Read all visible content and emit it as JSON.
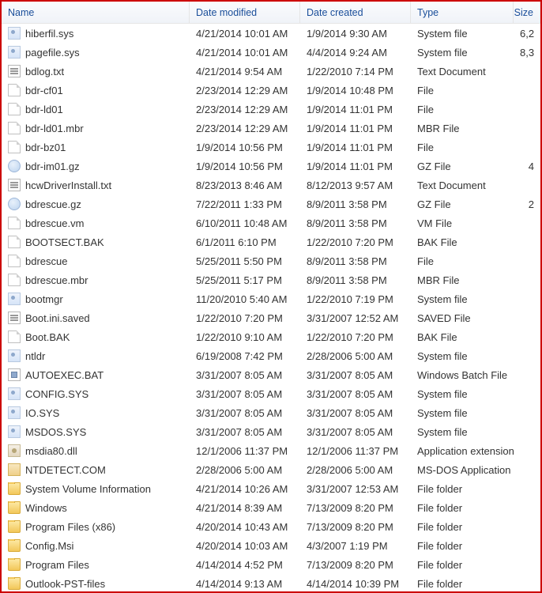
{
  "columns": {
    "name": "Name",
    "modified": "Date modified",
    "created": "Date created",
    "type": "Type",
    "size": "Size"
  },
  "files": [
    {
      "icon": "sys",
      "name": "hiberfil.sys",
      "modified": "4/21/2014 10:01 AM",
      "created": "1/9/2014 9:30 AM",
      "type": "System file",
      "size": "6,2"
    },
    {
      "icon": "sys",
      "name": "pagefile.sys",
      "modified": "4/21/2014 10:01 AM",
      "created": "4/4/2014 9:24 AM",
      "type": "System file",
      "size": "8,3"
    },
    {
      "icon": "txt",
      "name": "bdlog.txt",
      "modified": "4/21/2014 9:54 AM",
      "created": "1/22/2010 7:14 PM",
      "type": "Text Document",
      "size": ""
    },
    {
      "icon": "file",
      "name": "bdr-cf01",
      "modified": "2/23/2014 12:29 AM",
      "created": "1/9/2014 10:48 PM",
      "type": "File",
      "size": ""
    },
    {
      "icon": "file",
      "name": "bdr-ld01",
      "modified": "2/23/2014 12:29 AM",
      "created": "1/9/2014 11:01 PM",
      "type": "File",
      "size": ""
    },
    {
      "icon": "file",
      "name": "bdr-ld01.mbr",
      "modified": "2/23/2014 12:29 AM",
      "created": "1/9/2014 11:01 PM",
      "type": "MBR File",
      "size": ""
    },
    {
      "icon": "file",
      "name": "bdr-bz01",
      "modified": "1/9/2014 10:56 PM",
      "created": "1/9/2014 11:01 PM",
      "type": "File",
      "size": ""
    },
    {
      "icon": "gz",
      "name": "bdr-im01.gz",
      "modified": "1/9/2014 10:56 PM",
      "created": "1/9/2014 11:01 PM",
      "type": "GZ File",
      "size": "4"
    },
    {
      "icon": "txt",
      "name": "hcwDriverInstall.txt",
      "modified": "8/23/2013 8:46 AM",
      "created": "8/12/2013 9:57 AM",
      "type": "Text Document",
      "size": ""
    },
    {
      "icon": "gz",
      "name": "bdrescue.gz",
      "modified": "7/22/2011 1:33 PM",
      "created": "8/9/2011 3:58 PM",
      "type": "GZ File",
      "size": "2"
    },
    {
      "icon": "file",
      "name": "bdrescue.vm",
      "modified": "6/10/2011 10:48 AM",
      "created": "8/9/2011 3:58 PM",
      "type": "VM File",
      "size": ""
    },
    {
      "icon": "file",
      "name": "BOOTSECT.BAK",
      "modified": "6/1/2011 6:10 PM",
      "created": "1/22/2010 7:20 PM",
      "type": "BAK File",
      "size": ""
    },
    {
      "icon": "file",
      "name": "bdrescue",
      "modified": "5/25/2011 5:50 PM",
      "created": "8/9/2011 3:58 PM",
      "type": "File",
      "size": ""
    },
    {
      "icon": "file",
      "name": "bdrescue.mbr",
      "modified": "5/25/2011 5:17 PM",
      "created": "8/9/2011 3:58 PM",
      "type": "MBR File",
      "size": ""
    },
    {
      "icon": "sys",
      "name": "bootmgr",
      "modified": "11/20/2010 5:40 AM",
      "created": "1/22/2010 7:19 PM",
      "type": "System file",
      "size": ""
    },
    {
      "icon": "txt",
      "name": "Boot.ini.saved",
      "modified": "1/22/2010 7:20 PM",
      "created": "3/31/2007 12:52 AM",
      "type": "SAVED File",
      "size": ""
    },
    {
      "icon": "file",
      "name": "Boot.BAK",
      "modified": "1/22/2010 9:10 AM",
      "created": "1/22/2010 7:20 PM",
      "type": "BAK File",
      "size": ""
    },
    {
      "icon": "sys",
      "name": "ntldr",
      "modified": "6/19/2008 7:42 PM",
      "created": "2/28/2006 5:00 AM",
      "type": "System file",
      "size": ""
    },
    {
      "icon": "bat",
      "name": "AUTOEXEC.BAT",
      "modified": "3/31/2007 8:05 AM",
      "created": "3/31/2007 8:05 AM",
      "type": "Windows Batch File",
      "size": ""
    },
    {
      "icon": "sys",
      "name": "CONFIG.SYS",
      "modified": "3/31/2007 8:05 AM",
      "created": "3/31/2007 8:05 AM",
      "type": "System file",
      "size": ""
    },
    {
      "icon": "sys",
      "name": "IO.SYS",
      "modified": "3/31/2007 8:05 AM",
      "created": "3/31/2007 8:05 AM",
      "type": "System file",
      "size": ""
    },
    {
      "icon": "sys",
      "name": "MSDOS.SYS",
      "modified": "3/31/2007 8:05 AM",
      "created": "3/31/2007 8:05 AM",
      "type": "System file",
      "size": ""
    },
    {
      "icon": "dll",
      "name": "msdia80.dll",
      "modified": "12/1/2006 11:37 PM",
      "created": "12/1/2006 11:37 PM",
      "type": "Application extension",
      "size": ""
    },
    {
      "icon": "com",
      "name": "NTDETECT.COM",
      "modified": "2/28/2006 5:00 AM",
      "created": "2/28/2006 5:00 AM",
      "type": "MS-DOS Application",
      "size": ""
    },
    {
      "icon": "folder",
      "name": "System Volume Information",
      "modified": "4/21/2014 10:26 AM",
      "created": "3/31/2007 12:53 AM",
      "type": "File folder",
      "size": ""
    },
    {
      "icon": "folder",
      "name": "Windows",
      "modified": "4/21/2014 8:39 AM",
      "created": "7/13/2009 8:20 PM",
      "type": "File folder",
      "size": ""
    },
    {
      "icon": "folder",
      "name": "Program Files (x86)",
      "modified": "4/20/2014 10:43 AM",
      "created": "7/13/2009 8:20 PM",
      "type": "File folder",
      "size": ""
    },
    {
      "icon": "folder",
      "name": "Config.Msi",
      "modified": "4/20/2014 10:03 AM",
      "created": "4/3/2007 1:19 PM",
      "type": "File folder",
      "size": ""
    },
    {
      "icon": "folder",
      "name": "Program Files",
      "modified": "4/14/2014 4:52 PM",
      "created": "7/13/2009 8:20 PM",
      "type": "File folder",
      "size": ""
    },
    {
      "icon": "folder",
      "name": "Outlook-PST-files",
      "modified": "4/14/2014 9:13 AM",
      "created": "4/14/2014 10:39 PM",
      "type": "File folder",
      "size": ""
    }
  ]
}
